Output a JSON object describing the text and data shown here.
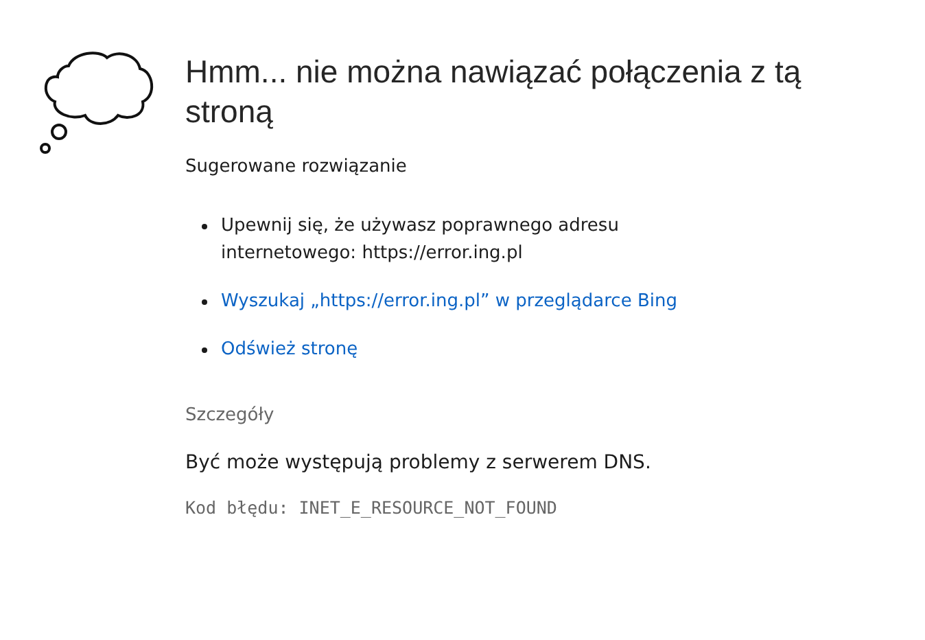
{
  "title": "Hmm... nie można nawiązać połączenia z tą stroną",
  "suggestions_heading": "Sugerowane rozwiązanie",
  "suggestions": [
    {
      "kind": "text",
      "text": "Upewnij się, że używasz poprawnego adresu internetowego: https://error.ing.pl"
    },
    {
      "kind": "link",
      "text": "Wyszukaj „https://error.ing.pl” w przeglądarce Bing"
    },
    {
      "kind": "link",
      "text": "Odśwież stronę"
    }
  ],
  "details_heading": "Szczegóły",
  "details_text": "Być może występują problemy z serwerem DNS.",
  "error_code": "Kod błędu: INET_E_RESOURCE_NOT_FOUND"
}
